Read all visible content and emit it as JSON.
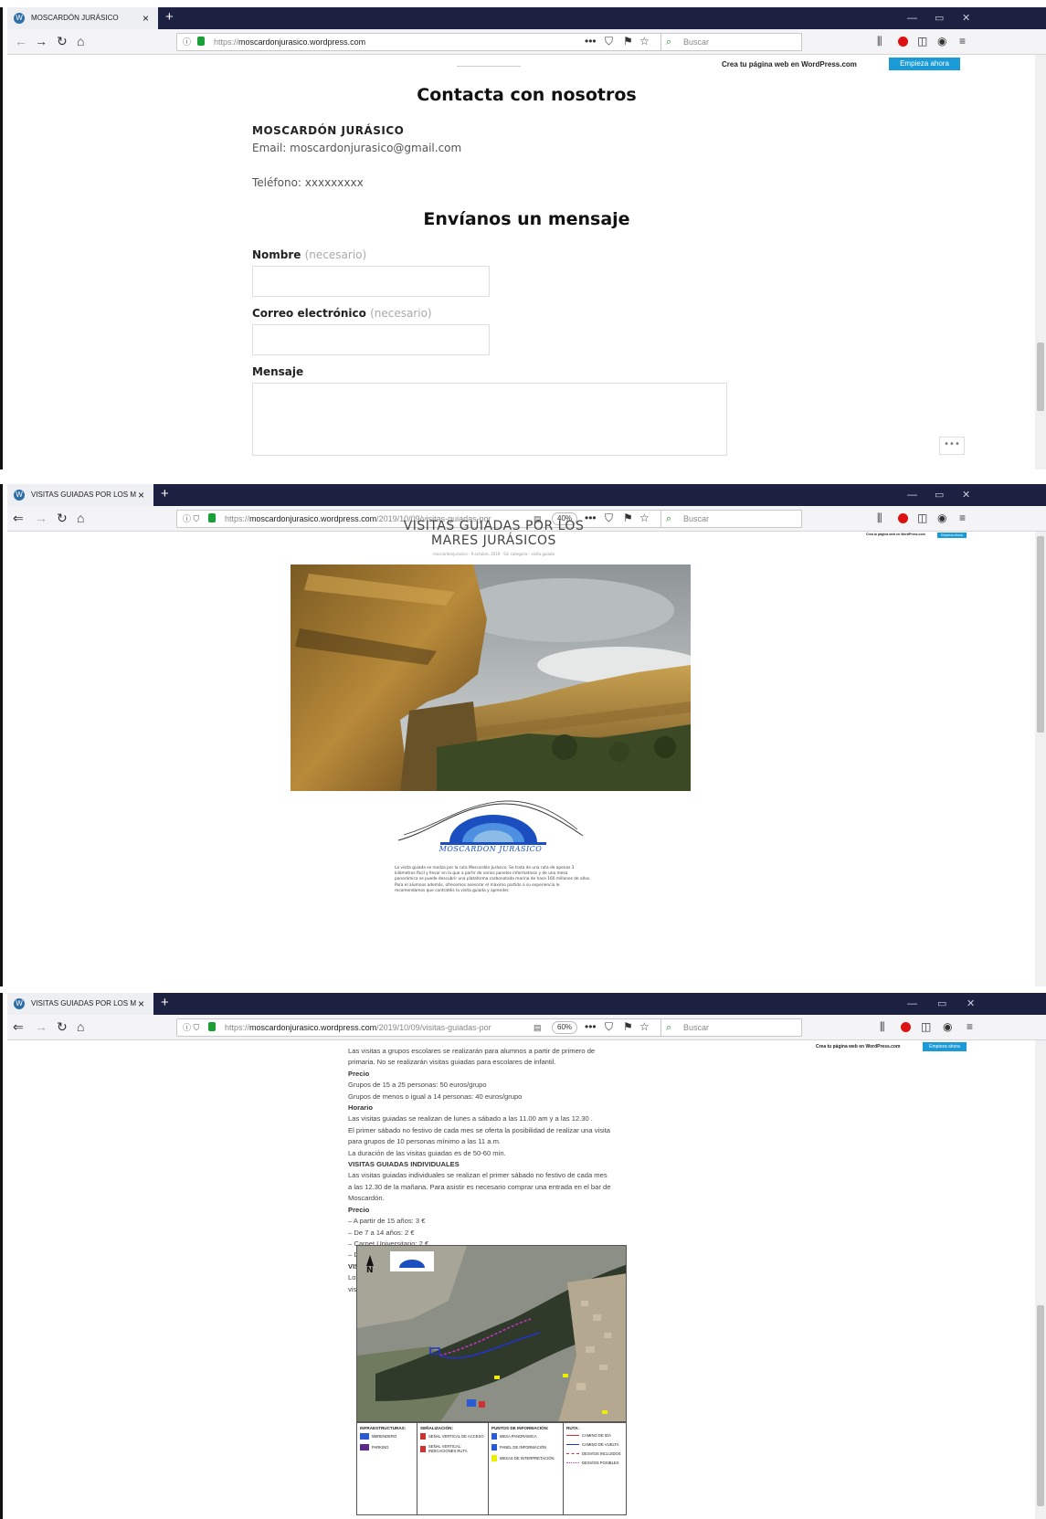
{
  "shot1": {
    "tab_title": "MOSCARDÓN JURÁSICO",
    "url": "https://moscardonjurasico.wordpress.com",
    "url_prefix": "https://",
    "url_domain": "moscardonjurasico.wordpress.com",
    "url_path": "",
    "search_placeholder": "Buscar",
    "wp_bar": {
      "crea": "Crea tu página web en WordPress.com",
      "empieza": "Empieza ahora"
    },
    "contact_title": "Contacta con nosotros",
    "org_name": "MOSCARDÓN JURÁSICO",
    "email_line": "Email: moscardonjurasico@gmail.com",
    "phone_line": "Teléfono: xxxxxxxxx",
    "form_title": "Envíanos un mensaje",
    "nombre_label": "Nombre",
    "correo_label": "Correo electrónico",
    "required": "(necesario)",
    "mensaje_label": "Mensaje",
    "more_button": "•••"
  },
  "shot2": {
    "tab_title": "VISITAS GUIADAS POR LOS M",
    "url_prefix": "https://",
    "url_domain": "moscardonjurasico.wordpress.com",
    "url_path": "/2019/10/09/visitas-guiadas-por",
    "zoom": "40%",
    "search_placeholder": "Buscar",
    "wp_bar": {
      "crea": "Crea tu página web en WordPress.com",
      "empieza": "Empieza ahora"
    },
    "post_title_1": "VISITAS GUIADAS POR LOS",
    "post_title_2": "MARES JURÁSICOS",
    "post_meta": "moscardonjurasico · 9 octubre, 2019 · Sin categoría · visita guiada",
    "logo_text": "MOSCARDÓN JURÁSICO",
    "intro": "La visita guiada se realiza por la ruta Moscardón Jurásico. Se trata de una ruta de apenas 3 kilómetros fácil y llevar en la que a partir de varios paneles informativos y de una mesa panorámica se puede descubrir una plataforma carbonatada marina de hace 160 millones de años. Para el alumnos además, ofrecemos asesorar el máximo partido a su experiencia le recomendamos que contratéis la visita guiada y aprender."
  },
  "shot3": {
    "tab_title": "VISITAS GUIADAS POR LOS M",
    "url_prefix": "https://",
    "url_domain": "moscardonjurasico.wordpress.com",
    "url_path": "/2019/10/09/visitas-guiadas-por",
    "zoom": "60%",
    "search_placeholder": "Buscar",
    "wp_bar": {
      "crea": "Crea tu página web en WordPress.com",
      "empieza": "Empieza ahora"
    },
    "lines": [
      {
        "t": "Las visitas a grupos escolares se realizarán para alumnos a partir de primero de",
        "h": false
      },
      {
        "t": "primaria. No se realizarán visitas guiadas para escolares de infantil.",
        "h": false
      },
      {
        "t": "Precio",
        "h": true
      },
      {
        "t": "Grupos de 15 a 25 personas: 50 euros/grupo",
        "h": false
      },
      {
        "t": "Grupos de menos o igual a 14 personas: 40 euros/grupo",
        "h": false
      },
      {
        "t": "Horario",
        "h": true
      },
      {
        "t": "Las visitas guiadas se realizan de lunes a sábado a las 11.00 am y a las 12.30 .",
        "h": false
      },
      {
        "t": "El primer sábado no festivo de cada mes se oferta la posibilidad de realizar una visita",
        "h": false
      },
      {
        "t": "para grupos de 10 personas mínimo a las 11 a.m.",
        "h": false
      },
      {
        "t": "La duración de las visitas guiadas es de 50-60 min.",
        "h": false
      },
      {
        "t": "VISITAS GUIADAS INDIVIDUALES",
        "h": true
      },
      {
        "t": "Las visitas guiadas individuales se realizan el primer sábado no festivo de cada mes",
        "h": false
      },
      {
        "t": "a las 12.30 de la mañana. Para asistir es necesario comprar una entrada en el bar de",
        "h": false
      },
      {
        "t": "Moscardón.",
        "h": false
      },
      {
        "t": "Precio",
        "h": true
      },
      {
        "t": "– A partir de 15 años: 3 €",
        "h": false
      },
      {
        "t": "– De 7 a 14 años: 2 €",
        "h": false
      },
      {
        "t": "– Carnet Universitario: 2 €",
        "h": false
      },
      {
        "t": "– De 0 a 6 años: gratis",
        "h": false
      },
      {
        "t": "VISITAS POR LIBRE",
        "h": true
      },
      {
        "t": "Los grupos que deseen hacer una visita por libre a la ruta deberán respetar a las",
        "h": false
      },
      {
        "t": "visitas guiadas",
        "h": false
      }
    ],
    "map_north": "N",
    "legend": {
      "infra": "INFRAESTRUCTURAS:",
      "infra_items": [
        "MERENDERO",
        "PARKING"
      ],
      "senal": "SEÑALIZACIÓN:",
      "senal_items": [
        "SEÑAL VERTICAL DE ACCESO",
        "SEÑAL VERTICAL: INDICACIONES RUTA"
      ],
      "puntos": "PUNTOS DE INFORMACIÓN:",
      "puntos_items": [
        "MESA PANORÁMICA",
        "PANEL DE INFORMACIÓN",
        "MESAS DE INTERPRETACIÓN"
      ],
      "ruta": "RUTA:",
      "ruta_items": [
        "CAMINO DE IDA",
        "CAMINO DE VUELTA",
        "DESVÍOS INCLUIDOS",
        "DESVÍOS POSIBLES"
      ]
    }
  },
  "colors": {
    "tabbar": "#1d2141",
    "accent": "#1a9bd7",
    "logo_blue": "#1b4fbf"
  }
}
